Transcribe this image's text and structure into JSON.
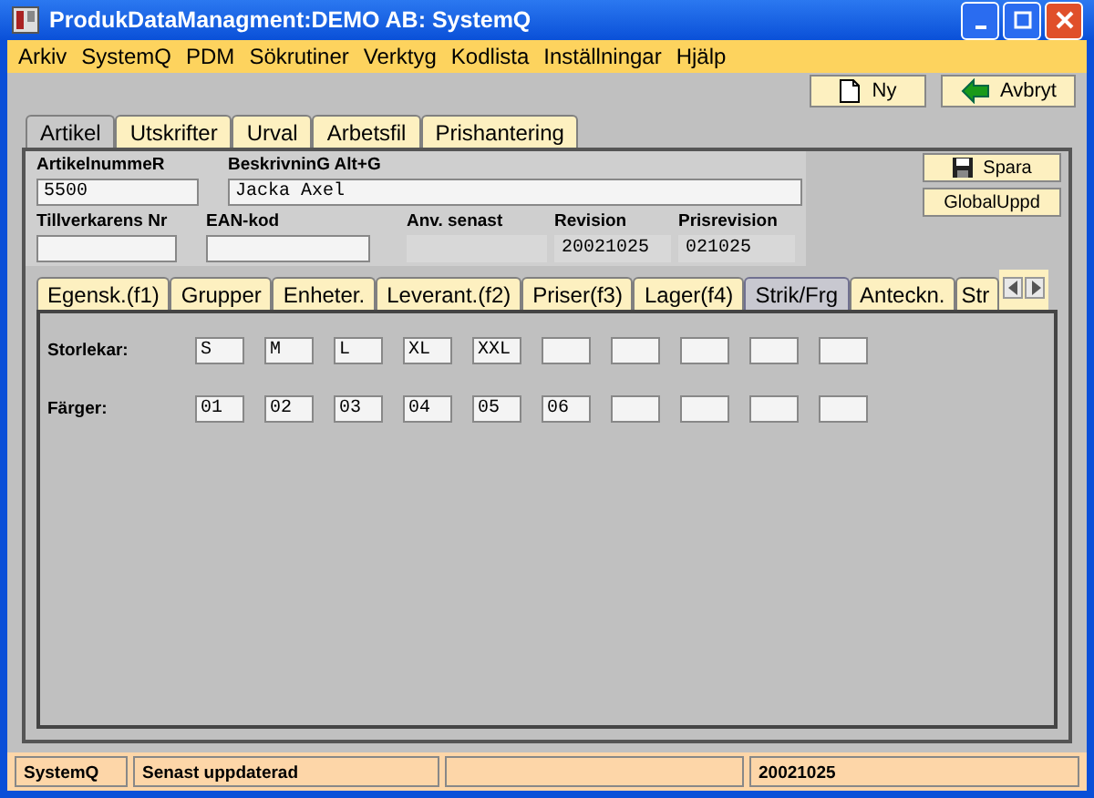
{
  "window": {
    "title": "ProdukDataManagment:DEMO AB: SystemQ"
  },
  "menu": [
    "Arkiv",
    "SystemQ",
    "PDM",
    "Sökrutiner",
    "Verktyg",
    "Kodlista",
    "Inställningar",
    "Hjälp"
  ],
  "toolbar": [
    {
      "label": "Ny",
      "kind": "new"
    },
    {
      "label": "Avbryt",
      "kind": "back"
    }
  ],
  "tabs": [
    {
      "label": "Artikel",
      "selected": true
    },
    {
      "label": "Utskrifter",
      "selected": false
    },
    {
      "label": "Urval",
      "selected": false
    },
    {
      "label": "Arbetsfil",
      "selected": false
    },
    {
      "label": "Prishantering",
      "selected": false
    }
  ],
  "fields_row1": [
    {
      "label": "ArtikelnummeR",
      "value": "5500",
      "kind": "input"
    },
    {
      "label": "BeskrivninG Alt+G",
      "value": "Jacka Axel",
      "kind": "wide"
    }
  ],
  "fields_row2": [
    {
      "label": "Tillverkarens Nr",
      "kind": "input"
    },
    {
      "label": "EAN-kod",
      "kind": "input"
    },
    {
      "label": "Anv. senast",
      "kind": "readonly"
    },
    {
      "label": "Revision",
      "value": "20021025",
      "kind": "readonly"
    },
    {
      "label": "Prisrevision",
      "value": "021025",
      "kind": "readonly"
    }
  ],
  "side_buttons": [
    {
      "label": "Spara",
      "kind": "save"
    },
    {
      "label": "GlobalUppd",
      "kind": "plain"
    }
  ],
  "subtabs": [
    {
      "label": "Egensk.(f1)",
      "selected": false
    },
    {
      "label": "Grupper",
      "selected": false
    },
    {
      "label": "Enheter.",
      "selected": false
    },
    {
      "label": "Leverant.(f2)",
      "selected": false
    },
    {
      "label": "Priser(f3)",
      "selected": false
    },
    {
      "label": "Lager(f4)",
      "selected": false
    },
    {
      "label": "Strik/Frg",
      "selected": true
    },
    {
      "label": "Anteckn.",
      "selected": false
    },
    {
      "label": "Str",
      "selected": false
    }
  ],
  "grid_rows": [
    {
      "label": "Storlekar:",
      "cells": [
        "S",
        "M",
        "L",
        "XL",
        "XXL",
        null,
        null,
        null,
        null,
        null
      ]
    },
    {
      "label": "Färger:",
      "cells": [
        "01",
        "02",
        "03",
        "04",
        "05",
        "06",
        null,
        null,
        null,
        null
      ]
    }
  ],
  "status_bar": [
    "SystemQ",
    "Senast uppdaterad",
    "20021025"
  ]
}
